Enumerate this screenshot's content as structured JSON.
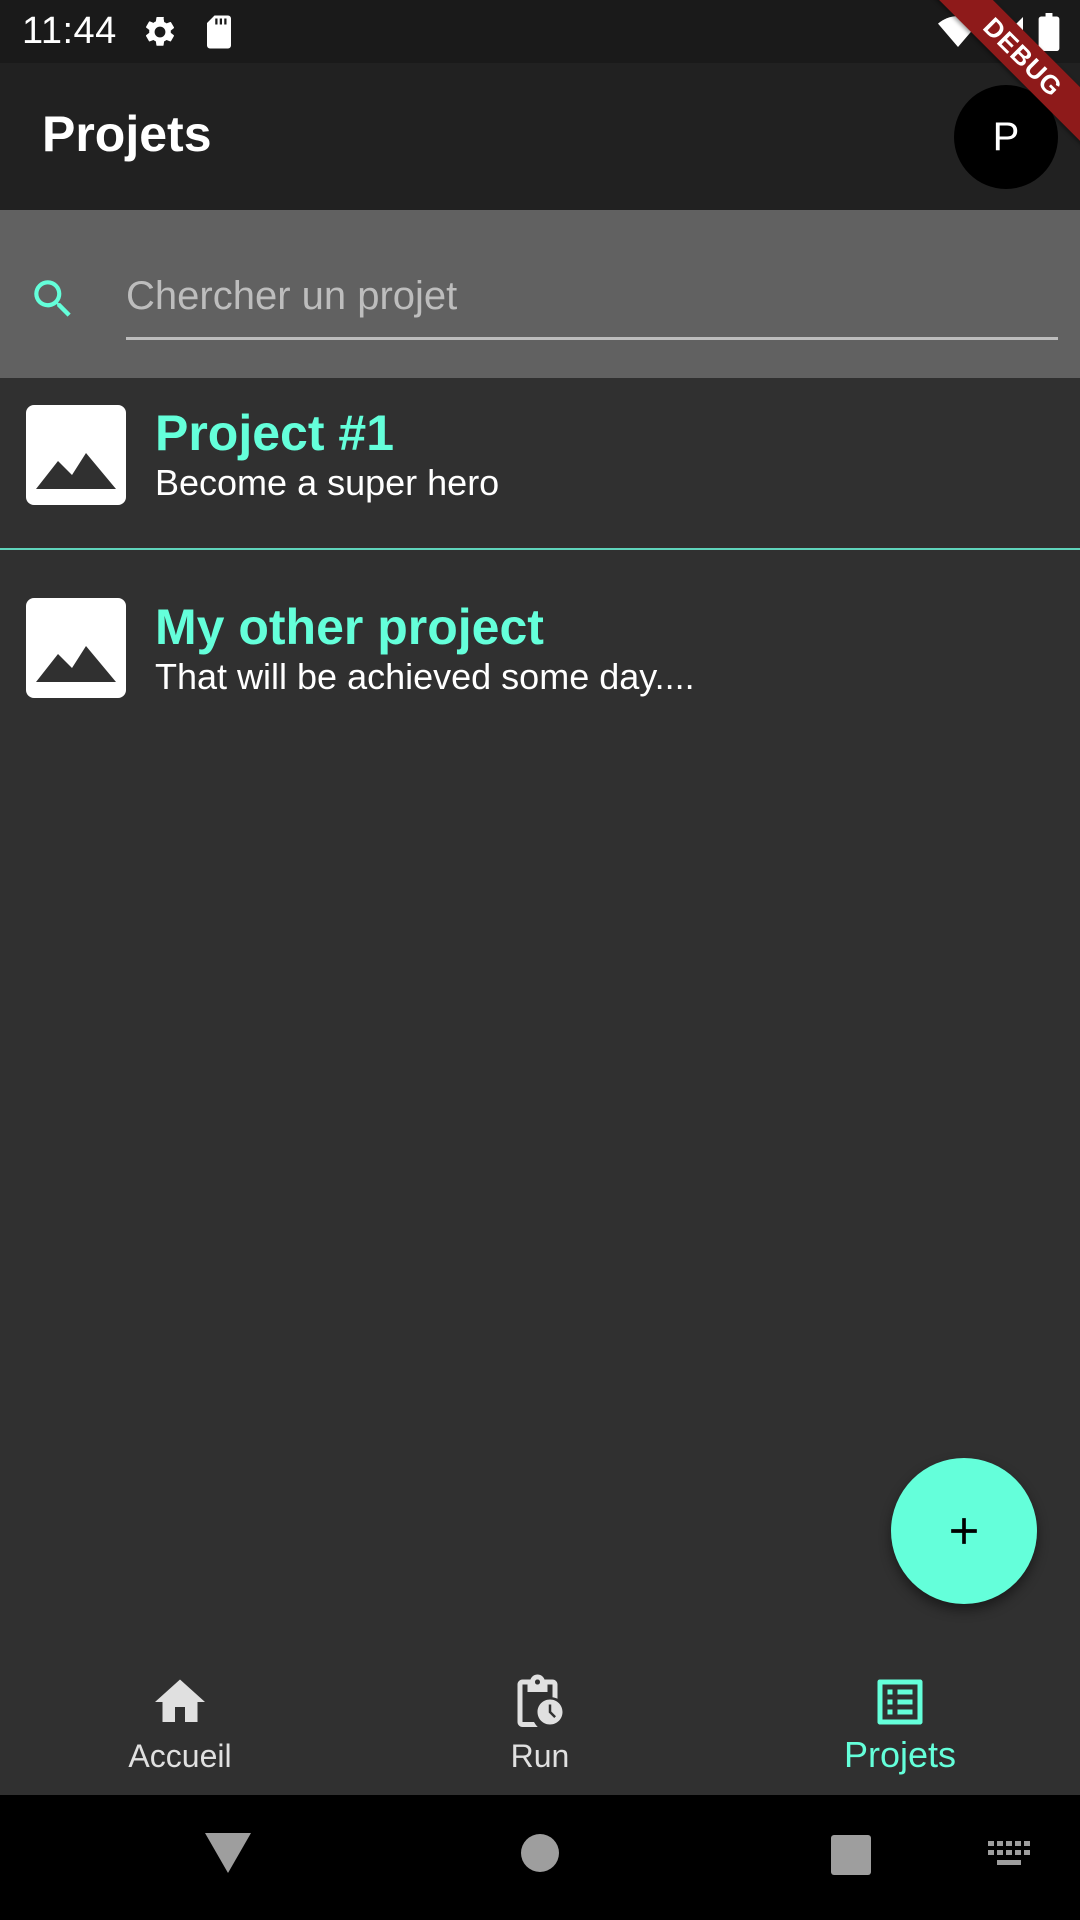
{
  "status_bar": {
    "time": "11:44",
    "icons": [
      "gear-icon",
      "sd-card-icon",
      "wifi-icon",
      "signal-icon",
      "battery-icon"
    ]
  },
  "debug_banner": {
    "label": "DEBUG",
    "color": "#8e1a1a"
  },
  "app_bar": {
    "title": "Projets",
    "avatar_initial": "P"
  },
  "search": {
    "placeholder": "Chercher un projet",
    "value": ""
  },
  "projects": [
    {
      "title": "Project #1",
      "subtitle": "Become a super hero",
      "thumbnail_icon": "image-icon"
    },
    {
      "title": "My other project",
      "subtitle": "That will be achieved some day....",
      "thumbnail_icon": "image-icon"
    }
  ],
  "fab": {
    "icon": "plus-icon"
  },
  "bottom_nav": {
    "items": [
      {
        "label": "Accueil",
        "icon": "home-icon",
        "active": false
      },
      {
        "label": "Run",
        "icon": "clipboard-clock-icon",
        "active": false
      },
      {
        "label": "Projets",
        "icon": "list-icon",
        "active": true
      }
    ]
  },
  "system_nav": {
    "icons": [
      "back-icon",
      "home-circle-icon",
      "recents-icon",
      "keyboard-icon"
    ]
  },
  "colors": {
    "accent": "#64ffda",
    "background": "#303030",
    "app_bar": "#212121",
    "search_bar": "#616161",
    "status_bar": "#1a1a1a"
  }
}
